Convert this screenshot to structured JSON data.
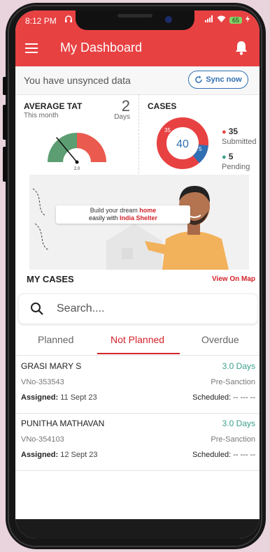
{
  "status_bar": {
    "time": "8:12 PM",
    "battery": "65"
  },
  "app_bar": {
    "title": "My Dashboard"
  },
  "sync": {
    "message": "You have unsynced data",
    "button_label": "Sync now"
  },
  "tat": {
    "title": "AVERAGE TAT",
    "period": "This month",
    "value": "2",
    "unit": "Days",
    "gauge_value": "2.0",
    "gauge_level": 0.28
  },
  "cases_summary": {
    "title": "CASES",
    "total": "40",
    "submitted_arc_label": "35",
    "pending_arc_label": "5",
    "submitted_count": "35",
    "submitted_label": "Submitted",
    "pending_count": "5",
    "pending_label": "Pending"
  },
  "banner": {
    "line1_part1": "Build your dream ",
    "line1_highlight": "home",
    "line2_part1": "easily with ",
    "line2_highlight": "India Shelter"
  },
  "my_cases": {
    "title": "MY CASES",
    "map_link": "View On Map"
  },
  "search": {
    "placeholder": "Search...."
  },
  "tabs": [
    {
      "label": "Planned"
    },
    {
      "label": "Not Planned"
    },
    {
      "label": "Overdue"
    }
  ],
  "cases": [
    {
      "name": "GRASI MARY S",
      "days": "3.0 Days",
      "vno": "VNo-353543",
      "stage": "Pre-Sanction",
      "assigned_label": "Assigned:",
      "assigned_date": "11 Sept 23",
      "scheduled_label": "Scheduled:",
      "scheduled_value": "-- --- --"
    },
    {
      "name": "PUNITHA MATHAVAN",
      "days": "3.0 Days",
      "vno": "VNo-354103",
      "stage": "Pre-Sanction",
      "assigned_label": "Assigned:",
      "assigned_date": "12 Sept 23",
      "scheduled_label": "Scheduled:",
      "scheduled_value": "-- --- --"
    }
  ],
  "colors": {
    "brand_red": "#e84142",
    "accent_blue": "#2f6fb4",
    "teal": "#3a9f8e",
    "gauge_green": "#5c9e72"
  }
}
